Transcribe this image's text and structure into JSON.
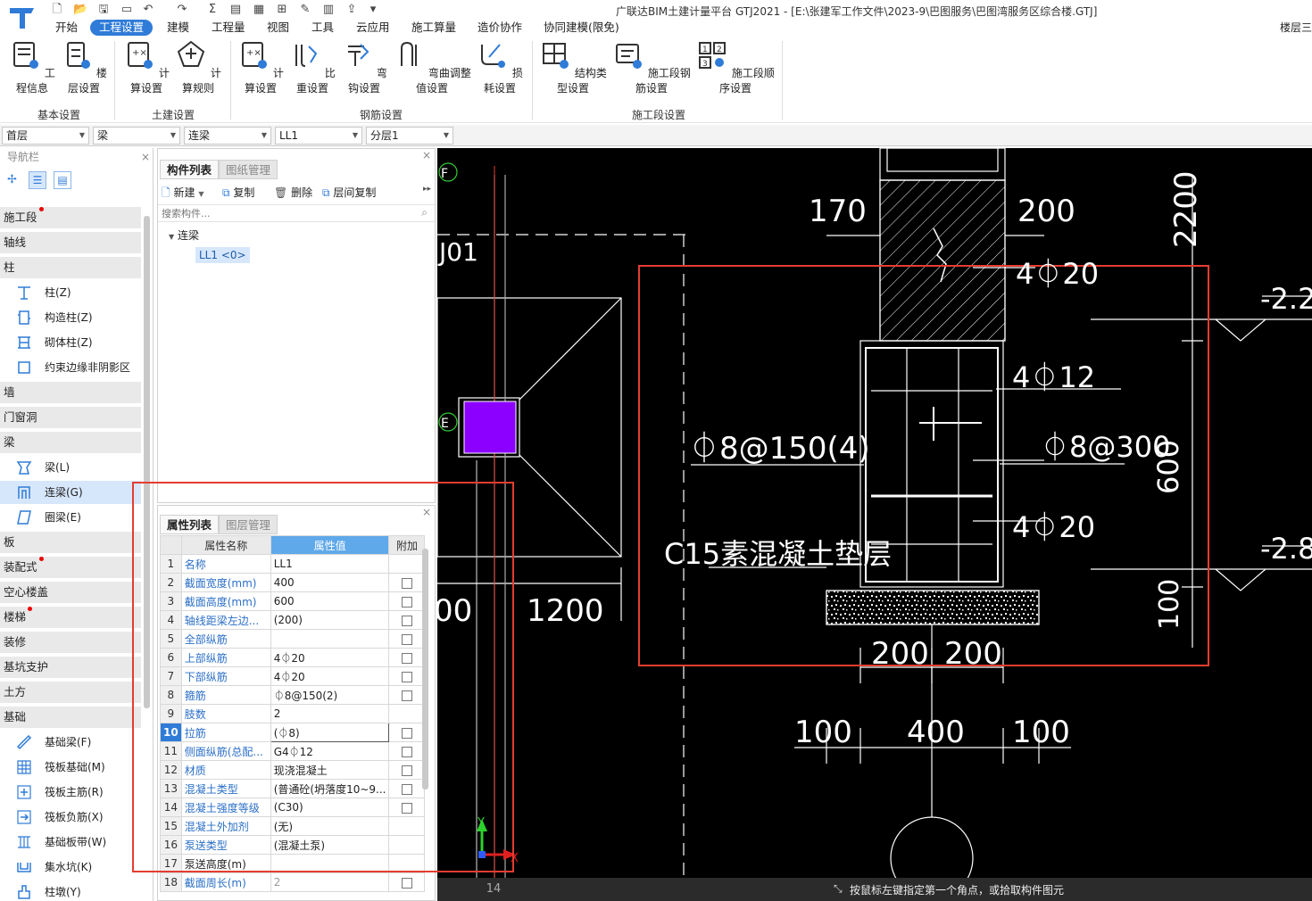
{
  "app": {
    "window_title": "广联达BIM土建计量平台 GTJ2021 - [E:\\张建军工作文件\\2023-9\\巴图服务\\巴图湾服务区综合楼.GTJ]",
    "layer_control": "楼层三"
  },
  "menu": [
    "开始",
    "工程设置",
    "建模",
    "工程量",
    "视图",
    "工具",
    "云应用",
    "施工算量",
    "造价协作",
    "协同建模(限免)"
  ],
  "menu_active_index": 1,
  "ribbon": {
    "groups": [
      {
        "name": "基本设置",
        "buttons": [
          "工程信息",
          "楼层设置"
        ]
      },
      {
        "name": "土建设置",
        "buttons": [
          "计算设置",
          "计算规则"
        ]
      },
      {
        "name": "钢筋设置",
        "buttons": [
          "计算设置",
          "比重设置",
          "弯钩设置",
          "弯曲调整值设置",
          "损耗设置"
        ]
      },
      {
        "name": "施工段设置",
        "buttons": [
          "结构类型设置",
          "施工段钢筋设置",
          "施工段顺序设置"
        ]
      }
    ]
  },
  "filters": [
    "首层",
    "梁",
    "连梁",
    "LL1",
    "分层1"
  ],
  "nav": {
    "header": "导航栏",
    "cat_shigongduan": "施工段",
    "cat_zhouxian": "轴线",
    "cat_zhu": "柱",
    "item_zhu": "柱(Z)",
    "item_gouzaozhu": "构造柱(Z)",
    "item_qitizhu": "砌体柱(Z)",
    "item_yueshu": "约束边缘非阴影区(Z",
    "cat_qiang": "墙",
    "cat_menchuang": "门窗洞",
    "cat_liang": "梁",
    "item_liang": "梁(L)",
    "item_lianliang": "连梁(G)",
    "item_quanliang": "圈梁(E)",
    "cat_ban": "板",
    "cat_zhuangpei": "装配式",
    "cat_kongxin": "空心楼盖",
    "cat_louti": "楼梯",
    "cat_zhuangxiu": "装修",
    "cat_jikeng": "基坑支护",
    "cat_tufang": "土方",
    "cat_jichu": "基础",
    "item_jichuliang": "基础梁(F)",
    "item_fabanjichu": "筏板基础(M)",
    "item_fabanzhujin": "筏板主筋(R)",
    "item_fabanfujin": "筏板负筋(X)",
    "item_jichubandai": "基础板带(W)",
    "item_jishuikeng": "集水坑(K)",
    "item_zhudun": "柱墩(Y)"
  },
  "component_list": {
    "tab_active": "构件列表",
    "tab_other": "图纸管理",
    "btn_new": "新建",
    "btn_copy": "复制",
    "btn_delete": "删除",
    "btn_layer_copy": "层间复制",
    "search_placeholder": "搜索构件...",
    "tree_root": "连梁",
    "tree_child": "LL1 <0>"
  },
  "properties": {
    "tab_active": "属性列表",
    "tab_other": "图层管理",
    "col_name": "属性名称",
    "col_value": "属性值",
    "col_extra": "附加",
    "rows": [
      {
        "n": "1",
        "name": "名称",
        "value": "LL1",
        "cb": false
      },
      {
        "n": "2",
        "name": "截面宽度(mm)",
        "value": "400",
        "cb": true
      },
      {
        "n": "3",
        "name": "截面高度(mm)",
        "value": "600",
        "cb": true
      },
      {
        "n": "4",
        "name": "轴线距梁左边...",
        "value": "(200)",
        "cb": true
      },
      {
        "n": "5",
        "name": "全部纵筋",
        "value": "",
        "cb": true
      },
      {
        "n": "6",
        "name": "上部纵筋",
        "value": "4⏀20",
        "cb": true
      },
      {
        "n": "7",
        "name": "下部纵筋",
        "value": "4⏀20",
        "cb": true
      },
      {
        "n": "8",
        "name": "箍筋",
        "value": "⏀8@150(2)",
        "cb": true
      },
      {
        "n": "9",
        "name": "肢数",
        "value": "2",
        "cb": false
      },
      {
        "n": "10",
        "name": "拉筋",
        "value": "(⏀8)",
        "cb": true
      },
      {
        "n": "11",
        "name": "侧面纵筋(总配...",
        "value": "G4⏀12",
        "cb": true
      },
      {
        "n": "12",
        "name": "材质",
        "value": "现浇混凝土",
        "cb": true
      },
      {
        "n": "13",
        "name": "混凝土类型",
        "value": "(普通砼(坍落度10~9...",
        "cb": true
      },
      {
        "n": "14",
        "name": "混凝土强度等级",
        "value": "(C30)",
        "cb": true
      },
      {
        "n": "15",
        "name": "混凝土外加剂",
        "value": "(无)",
        "cb": false
      },
      {
        "n": "16",
        "name": "泵送类型",
        "value": "(混凝土泵)",
        "cb": false
      },
      {
        "n": "17",
        "name": "泵送高度(m)",
        "value": "",
        "cb": false
      },
      {
        "n": "18",
        "name": "截面周长(m)",
        "value": "2",
        "cb": true
      }
    ],
    "selected_row": "10"
  },
  "cad": {
    "axis_f": "F",
    "axis_e": "E",
    "label_j01": "J01",
    "dim_170": "170",
    "dim_200_top": "200",
    "dim_2200": "2200",
    "rebar_top": "4⏀20",
    "rebar_side": "4⏀12",
    "stirrup": "⏀8@150(4)",
    "tie": "⏀8@300",
    "dim_600": "600",
    "rebar_bottom": "4⏀20",
    "cushion": "C15素混凝土垫层",
    "dim_100_right": "100",
    "dim_200a": "200",
    "dim_200b": "200",
    "dim_100a": "100",
    "dim_400": "400",
    "dim_100b": "100",
    "dim_1200": "1200",
    "dim_00": "00",
    "elev_1": "-2.2",
    "elev_2": "-2.8",
    "grid_14": "14",
    "ucs_y": "Y",
    "ucs_x": "X"
  },
  "status": {
    "message": "按鼠标左键指定第一个角点，或拾取构件图元"
  },
  "colors": {
    "accent": "#2f7bd8",
    "annotation_red": "#e43d30",
    "column_fill": "#8b00ff"
  }
}
